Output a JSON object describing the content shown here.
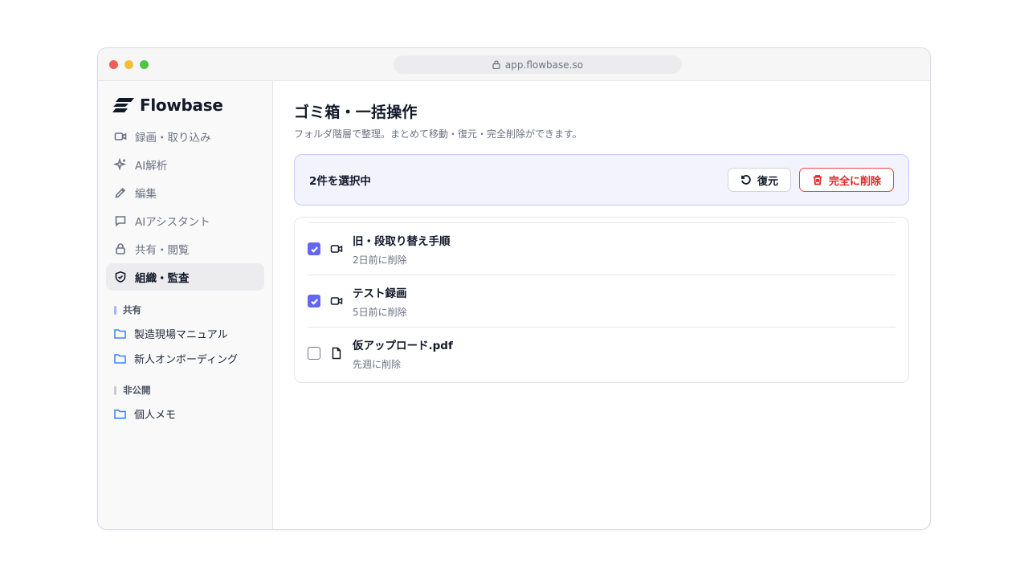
{
  "browser": {
    "url": "app.flowbase.so"
  },
  "brand": {
    "name": "Flowbase"
  },
  "nav": [
    {
      "label": "録画・取り込み",
      "icon": "video-icon"
    },
    {
      "label": "AI解析",
      "icon": "sparkle-icon"
    },
    {
      "label": "編集",
      "icon": "pencil-icon"
    },
    {
      "label": "AIアシスタント",
      "icon": "chat-icon"
    },
    {
      "label": "共有・閲覧",
      "icon": "lock-icon"
    },
    {
      "label": "組織・監査",
      "icon": "shield-icon",
      "active": true
    }
  ],
  "sections": {
    "shared": {
      "label": "共有",
      "folders": [
        "製造現場マニュアル",
        "新人オンボーディング"
      ]
    },
    "private": {
      "label": "非公開",
      "folders": [
        "個人メモ"
      ]
    }
  },
  "main": {
    "title": "ゴミ箱・一括操作",
    "subtitle": "フォルダ階層で整理。まとめて移動・復元・完全削除ができます。",
    "selection": {
      "count_text": "2件を選択中",
      "restore_label": "復元",
      "delete_label": "完全に削除"
    },
    "items": [
      {
        "title": "旧・段取り替え手順",
        "meta": "2日前に削除",
        "type": "video",
        "checked": true
      },
      {
        "title": "テスト録画",
        "meta": "5日前に削除",
        "type": "video",
        "checked": true
      },
      {
        "title": "仮アップロード.pdf",
        "meta": "先週に削除",
        "type": "file",
        "checked": false
      }
    ]
  },
  "colors": {
    "accent": "#6366f1",
    "danger": "#dc2626",
    "folder": "#3b82f6"
  }
}
